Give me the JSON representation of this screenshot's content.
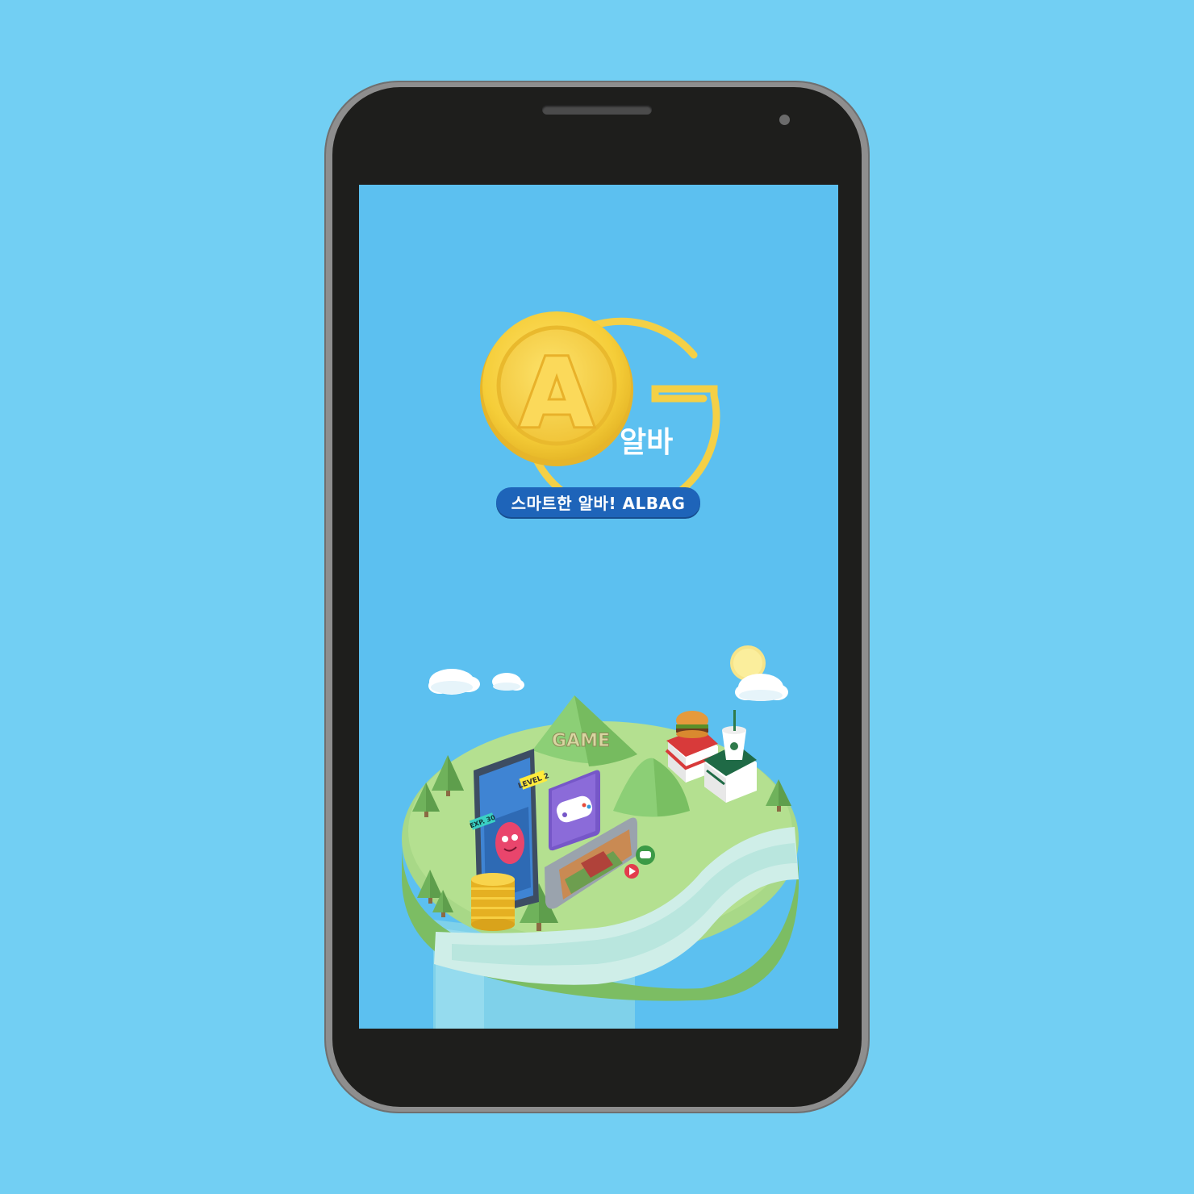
{
  "app": {
    "logo_word": "알바",
    "logo_letter": "A",
    "tagline": "스마트한 알바! ALBAG"
  },
  "illustration": {
    "game_label": "GAME",
    "level_badge": "LEVEL 2",
    "exp_badge": "EXP. 30"
  },
  "colors": {
    "background": "#72cff3",
    "screen": "#5cc0f0",
    "brand_blue": "#1e64b9",
    "coin_gold": "#f3cf3c"
  },
  "icons": [
    "coin-logo-icon",
    "cloud-icon",
    "sun-icon",
    "tree-icon",
    "gamepad-icon",
    "burger-icon",
    "drink-cup-icon",
    "chat-bubble-icon",
    "play-icon"
  ]
}
